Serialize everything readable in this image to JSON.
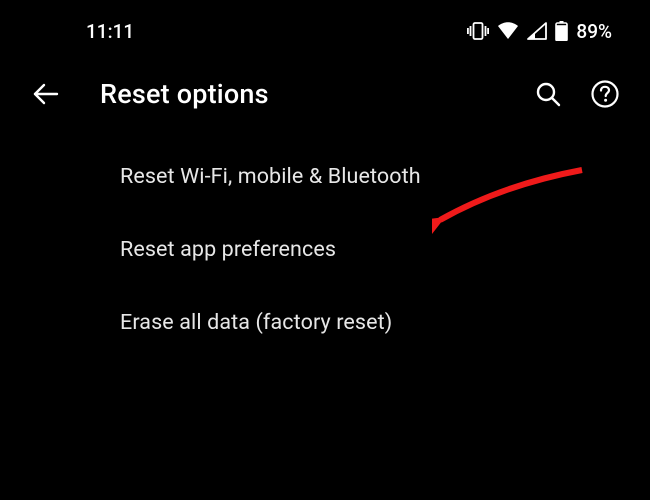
{
  "status_bar": {
    "time": "11:11",
    "battery_text": "89%"
  },
  "app_bar": {
    "title": "Reset options"
  },
  "list": {
    "items": [
      {
        "label": "Reset Wi-Fi, mobile & Bluetooth"
      },
      {
        "label": "Reset app preferences"
      },
      {
        "label": "Erase all data (factory reset)"
      }
    ]
  }
}
